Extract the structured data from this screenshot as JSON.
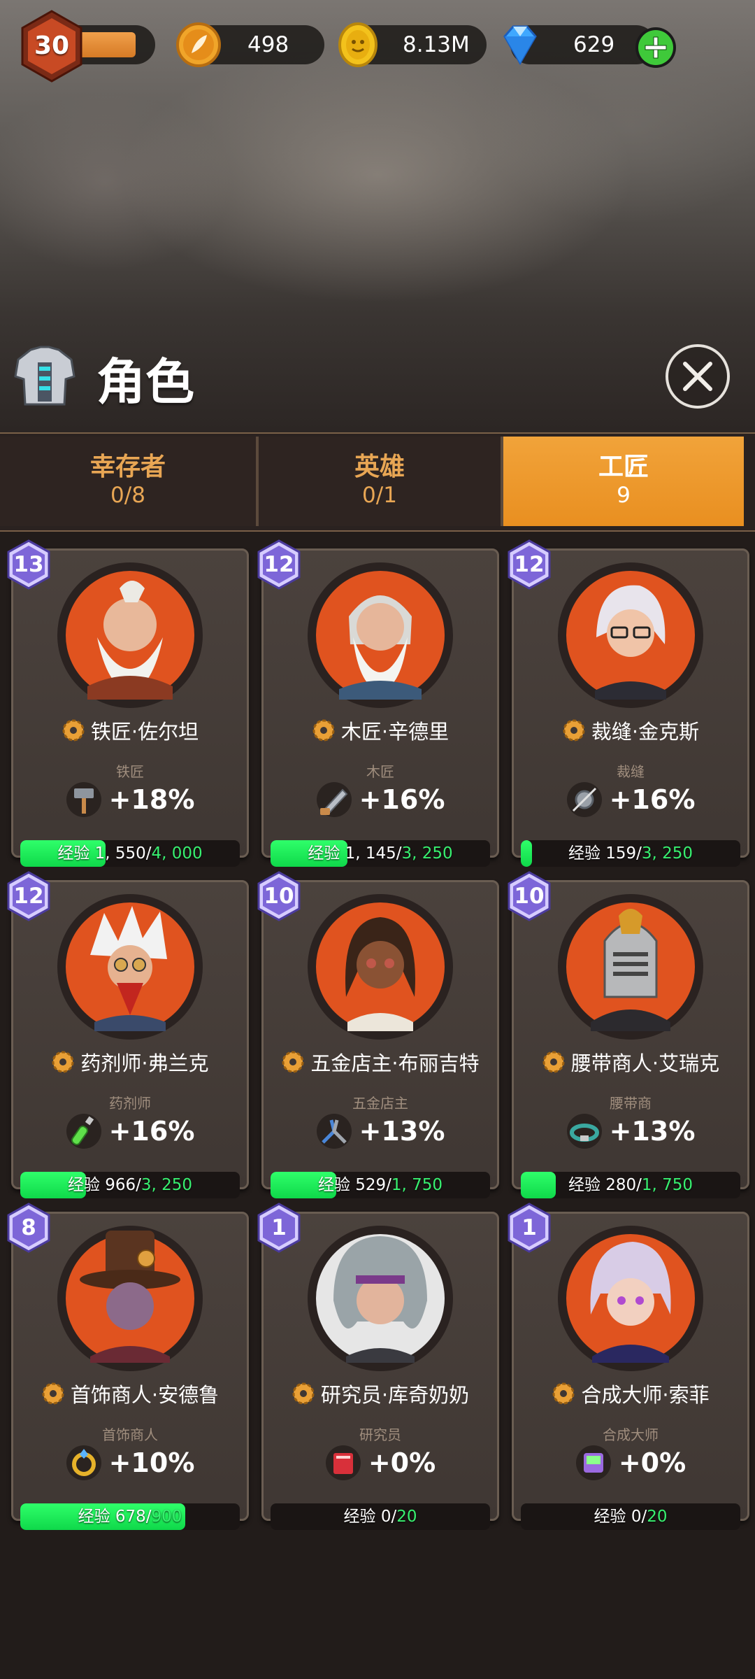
{
  "resources": {
    "level": "30",
    "level_progress": 0.75,
    "energy": "498",
    "gold": "8.13M",
    "gems": "629"
  },
  "page_title": "角色",
  "tabs": [
    {
      "label": "幸存者",
      "count": "0/8",
      "selected": false
    },
    {
      "label": "英雄",
      "count": "0/1",
      "selected": false
    },
    {
      "label": "工匠",
      "count": "9",
      "selected": true
    }
  ],
  "xp_label": "经验",
  "colors": {
    "accent": "#e98f20",
    "xp_green": "#1fe35a",
    "level_badge": "#7d66d8",
    "portrait_bg": "#e0531f"
  },
  "craftsmen": [
    {
      "level": "13",
      "name": "铁匠·佐尔坦",
      "role": "铁匠",
      "bonus": "+18%",
      "tool_icon": "hammer-icon",
      "xp": "1, 550",
      "xp_max": "4, 000",
      "progress": 0.39
    },
    {
      "level": "12",
      "name": "木匠·辛德里",
      "role": "木匠",
      "bonus": "+16%",
      "tool_icon": "saw-icon",
      "xp": "1, 145",
      "xp_max": "3, 250",
      "progress": 0.35
    },
    {
      "level": "12",
      "name": "裁缝·金克斯",
      "role": "裁缝",
      "bonus": "+16%",
      "tool_icon": "sewing-icon",
      "xp": "159",
      "xp_max": "3, 250",
      "progress": 0.05
    },
    {
      "level": "12",
      "name": "药剂师·弗兰克",
      "role": "药剂师",
      "bonus": "+16%",
      "tool_icon": "potion-icon",
      "xp": "966",
      "xp_max": "3, 250",
      "progress": 0.3
    },
    {
      "level": "10",
      "name": "五金店主·布丽吉特",
      "role": "五金店主",
      "bonus": "+13%",
      "tool_icon": "pliers-icon",
      "xp": "529",
      "xp_max": "1, 750",
      "progress": 0.3
    },
    {
      "level": "10",
      "name": "腰带商人·艾瑞克",
      "role": "腰带商",
      "bonus": "+13%",
      "tool_icon": "belt-icon",
      "xp": "280",
      "xp_max": "1, 750",
      "progress": 0.16
    },
    {
      "level": "8",
      "name": "首饰商人·安德鲁",
      "role": "首饰商人",
      "bonus": "+10%",
      "tool_icon": "ring-icon",
      "xp": "678",
      "xp_max": "900",
      "progress": 0.75
    },
    {
      "level": "1",
      "name": "研究员·库奇奶奶",
      "role": "研究员",
      "bonus": "+0%",
      "tool_icon": "book-icon",
      "xp": "0",
      "xp_max": "20",
      "progress": 0
    },
    {
      "level": "1",
      "name": "合成大师·索菲",
      "role": "合成大师",
      "bonus": "+0%",
      "tool_icon": "device-icon",
      "xp": "0",
      "xp_max": "20",
      "progress": 0
    }
  ]
}
